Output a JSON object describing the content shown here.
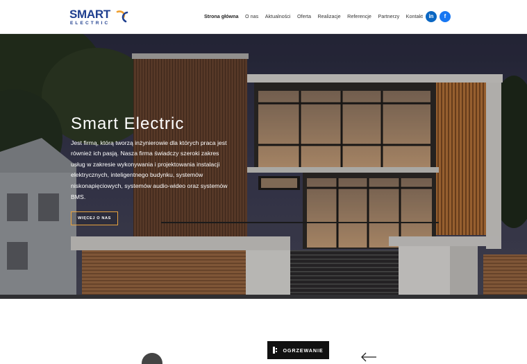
{
  "header": {
    "logo": {
      "word": "SMART",
      "sub": "ELECTRIC"
    },
    "nav": [
      {
        "label": "Strona główna",
        "active": true
      },
      {
        "label": "O nas"
      },
      {
        "label": "Aktualności"
      },
      {
        "label": "Oferta"
      },
      {
        "label": "Realizacje"
      },
      {
        "label": "Referencje"
      },
      {
        "label": "Partnerzy"
      },
      {
        "label": "Kontakt"
      }
    ],
    "social": {
      "linkedin": "in",
      "facebook": "f"
    }
  },
  "hero": {
    "title": "Smart Electric",
    "text": "Jest firmą, którą tworzą inżynierowie dla których praca jest również ich pasją. Nasza firma świadczy szeroki zakres usług w zakresie wykonywania i projektowania instalacji elektrycznych, inteligentnego budynku, systemów niskonapięciowych, systemów audio-wideo oraz systemów BMS.",
    "button": "WIĘCEJ O NAS"
  },
  "section": {
    "category_button": "OGRZEWANIE"
  },
  "colors": {
    "brand_blue": "#1f3f8f",
    "brand_orange": "#e7a23e",
    "linkedin": "#0a66c2",
    "facebook": "#1877f2"
  }
}
